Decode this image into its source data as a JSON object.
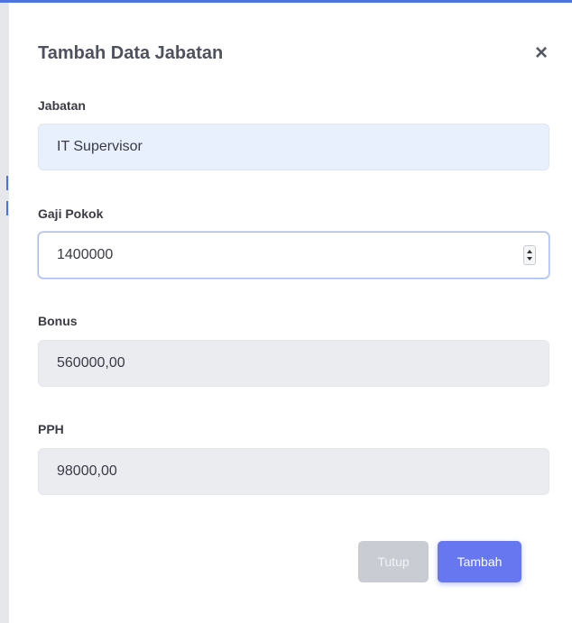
{
  "modal": {
    "title": "Tambah Data Jabatan",
    "close_icon": "close-icon",
    "close_glyph": "×"
  },
  "form": {
    "jabatan": {
      "label": "Jabatan",
      "value": "IT Supervisor"
    },
    "gaji_pokok": {
      "label": "Gaji Pokok",
      "value": "1400000"
    },
    "bonus": {
      "label": "Bonus",
      "value": "560000,00"
    },
    "pph": {
      "label": "PPH",
      "value": "98000,00"
    }
  },
  "footer": {
    "close_label": "Tutup",
    "add_label": "Tambah"
  },
  "colors": {
    "accent": "#6777ef",
    "top_line": "#4e73df",
    "readonly_bg": "#eaecf0",
    "autofill_bg": "#e8f0fe",
    "disabled_button": "#c9ccd2"
  }
}
